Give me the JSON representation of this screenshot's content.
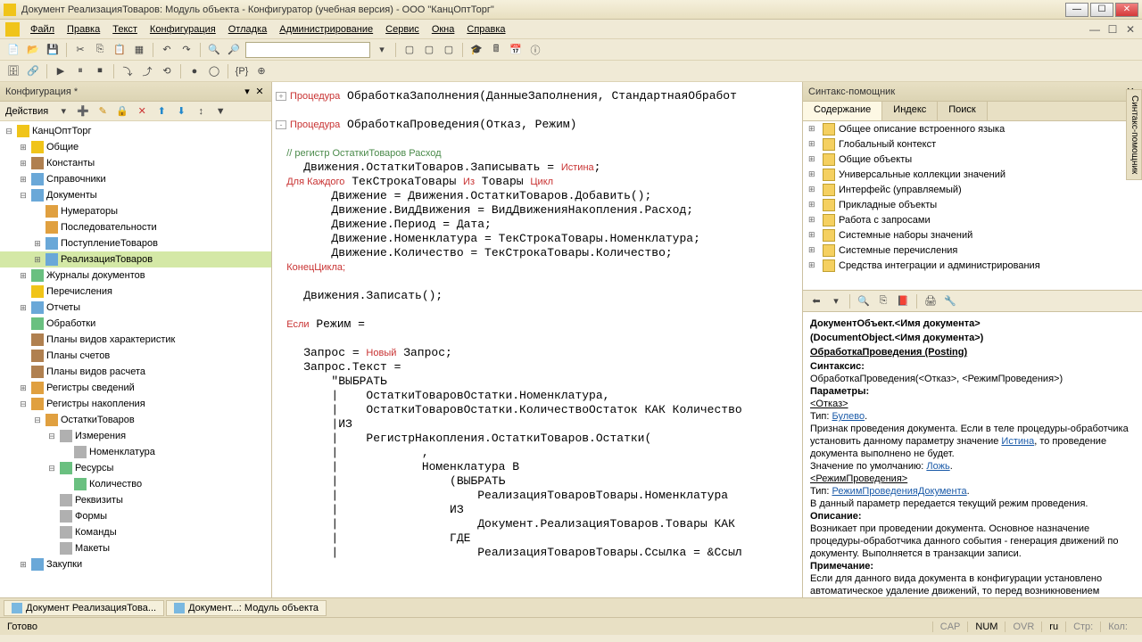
{
  "title": "Документ РеализацияТоваров: Модуль объекта - Конфигуратор (учебная версия) - ООО \"КанцОптТорг\"",
  "menu": [
    "Файл",
    "Правка",
    "Текст",
    "Конфигурация",
    "Отладка",
    "Администрирование",
    "Сервис",
    "Окна",
    "Справка"
  ],
  "config_panel": {
    "title": "Конфигурация *",
    "actions_label": "Действия"
  },
  "tree": [
    {
      "l": 0,
      "exp": "-",
      "icon": "ic-yellow",
      "label": "КанцОптТорг"
    },
    {
      "l": 1,
      "exp": "+",
      "icon": "ic-yellow",
      "label": "Общие"
    },
    {
      "l": 1,
      "exp": "+",
      "icon": "ic-brown",
      "label": "Константы"
    },
    {
      "l": 1,
      "exp": "+",
      "icon": "ic-blue",
      "label": "Справочники"
    },
    {
      "l": 1,
      "exp": "-",
      "icon": "ic-blue",
      "label": "Документы"
    },
    {
      "l": 2,
      "exp": "",
      "icon": "ic-orange",
      "label": "Нумераторы"
    },
    {
      "l": 2,
      "exp": "",
      "icon": "ic-orange",
      "label": "Последовательности"
    },
    {
      "l": 2,
      "exp": "+",
      "icon": "ic-blue",
      "label": "ПоступлениеТоваров"
    },
    {
      "l": 2,
      "exp": "+",
      "icon": "ic-blue",
      "label": "РеализацияТоваров",
      "sel": true
    },
    {
      "l": 1,
      "exp": "+",
      "icon": "ic-green",
      "label": "Журналы документов"
    },
    {
      "l": 1,
      "exp": "",
      "icon": "ic-yellow",
      "label": "Перечисления"
    },
    {
      "l": 1,
      "exp": "+",
      "icon": "ic-blue",
      "label": "Отчеты"
    },
    {
      "l": 1,
      "exp": "",
      "icon": "ic-green",
      "label": "Обработки"
    },
    {
      "l": 1,
      "exp": "",
      "icon": "ic-brown",
      "label": "Планы видов характеристик"
    },
    {
      "l": 1,
      "exp": "",
      "icon": "ic-brown",
      "label": "Планы счетов"
    },
    {
      "l": 1,
      "exp": "",
      "icon": "ic-brown",
      "label": "Планы видов расчета"
    },
    {
      "l": 1,
      "exp": "+",
      "icon": "ic-orange",
      "label": "Регистры сведений"
    },
    {
      "l": 1,
      "exp": "-",
      "icon": "ic-orange",
      "label": "Регистры накопления"
    },
    {
      "l": 2,
      "exp": "-",
      "icon": "ic-orange",
      "label": "ОстаткиТоваров"
    },
    {
      "l": 3,
      "exp": "-",
      "icon": "ic-gray",
      "label": "Измерения"
    },
    {
      "l": 4,
      "exp": "",
      "icon": "ic-gray",
      "label": "Номенклатура"
    },
    {
      "l": 3,
      "exp": "-",
      "icon": "ic-green",
      "label": "Ресурсы"
    },
    {
      "l": 4,
      "exp": "",
      "icon": "ic-green",
      "label": "Количество"
    },
    {
      "l": 3,
      "exp": "",
      "icon": "ic-gray",
      "label": "Реквизиты"
    },
    {
      "l": 3,
      "exp": "",
      "icon": "ic-gray",
      "label": "Формы"
    },
    {
      "l": 3,
      "exp": "",
      "icon": "ic-gray",
      "label": "Команды"
    },
    {
      "l": 3,
      "exp": "",
      "icon": "ic-gray",
      "label": "Макеты"
    },
    {
      "l": 1,
      "exp": "+",
      "icon": "ic-blue",
      "label": "Закупки"
    }
  ],
  "syntax": {
    "title": "Синтакс-помощник",
    "tabs": [
      "Содержание",
      "Индекс",
      "Поиск"
    ],
    "items": [
      "Общее описание встроенного языка",
      "Глобальный контекст",
      "Общие объекты",
      "Универсальные коллекции значений",
      "Интерфейс (управляемый)",
      "Прикладные объекты",
      "Работа с запросами",
      "Системные наборы значений",
      "Системные перечисления",
      "Средства интеграции и администрирования"
    ],
    "help": {
      "h1a": "ДокументОбъект.<Имя документа>",
      "h1b": "(DocumentObject.<Имя документа>)",
      "h1c": "ОбработкаПроведения (Posting)",
      "syntax_label": "Синтаксис:",
      "syntax_val": "ОбработкаПроведения(<Отказ>, <РежимПроведения>)",
      "params_label": "Параметры:",
      "param1": "<Отказ>",
      "type_label": "Тип:",
      "type1": "Булево",
      "param1_desc1": "Признак проведения документа. Если в теле процедуры-обработчика установить данному параметру значение ",
      "istina": "Истина",
      "param1_desc2": ", то проведение документа выполнено не будет.",
      "default_label": "Значение по умолчанию: ",
      "lozh": "Ложь",
      "param2": "<РежимПроведения>",
      "type2": "РежимПроведенияДокумента",
      "param2_desc": "В данный параметр передается текущий режим проведения.",
      "desc_label": "Описание:",
      "desc_text": "Возникает при проведении документа. Основное назначение процедуры-обработчика данного события - генерация движений по документу. Выполняется в транзакции записи.",
      "note_label": "Примечание:",
      "note_text": "Если для данного вида документа в конфигурации установлено автоматическое удаление движений, то перед возникновением"
    }
  },
  "doctabs": [
    "Документ РеализацияТова...",
    "Документ...: Модуль объекта"
  ],
  "status": {
    "ready": "Готово",
    "cap": "CAP",
    "num": "NUM",
    "ovr": "OVR",
    "lang": "ru",
    "str": "Стр:",
    "kol": "Кол:"
  },
  "side_tab": "Синтакс-помощник",
  "code": {
    "l1a": "Процедура",
    "l1b": " ОбработкаЗаполнения(ДанныеЗаполнения, СтандартнаяОбработ",
    "l2a": "Процедура",
    "l2b": " ОбработкаПроведения(Отказ, Режим)",
    "l3": "    // регистр ОстаткиТоваров Расход",
    "l4a": "    Движения.ОстаткиТоваров.Записывать = ",
    "l4b": "Истина",
    "l4c": ";",
    "l5a": "    Для Каждого",
    "l5b": " ТекСтрокаТовары ",
    "l5c": "Из",
    "l5d": " Товары ",
    "l5e": "Цикл",
    "l6": "        Движение = Движения.ОстаткиТоваров.Добавить();",
    "l7": "        Движение.ВидДвижения = ВидДвиженияНакопления.Расход;",
    "l8": "        Движение.Период = Дата;",
    "l9": "        Движение.Номенклатура = ТекСтрокаТовары.Номенклатура;",
    "l10": "        Движение.Количество = ТекСтрокаТовары.Количество;",
    "l11": "    КонецЦикла;",
    "l12": "    Движения.Записать();",
    "l13a": "    Если",
    "l13b": " Режим =",
    "l14a": "    Запрос = ",
    "l14b": "Новый",
    "l14c": " Запрос;",
    "l15": "    Запрос.Текст =",
    "l16": "        \"ВЫБРАТЬ",
    "l17": "        |    ОстаткиТоваровОстатки.Номенклатура,",
    "l18": "        |    ОстаткиТоваровОстатки.КоличествоОстаток КАК Количество",
    "l19": "        |ИЗ",
    "l20": "        |    РегистрНакопления.ОстаткиТоваров.Остатки(",
    "l21": "        |            ,",
    "l22": "        |            Номенклатура В",
    "l23": "        |                (ВЫБРАТЬ",
    "l24": "        |                    РеализацияТоваровТовары.Номенклатура",
    "l25": "        |                ИЗ",
    "l26": "        |                    Документ.РеализацияТоваров.Товары КАК",
    "l27": "        |                ГДЕ",
    "l28": "        |                    РеализацияТоваровТовары.Ссылка = &Ссыл"
  }
}
